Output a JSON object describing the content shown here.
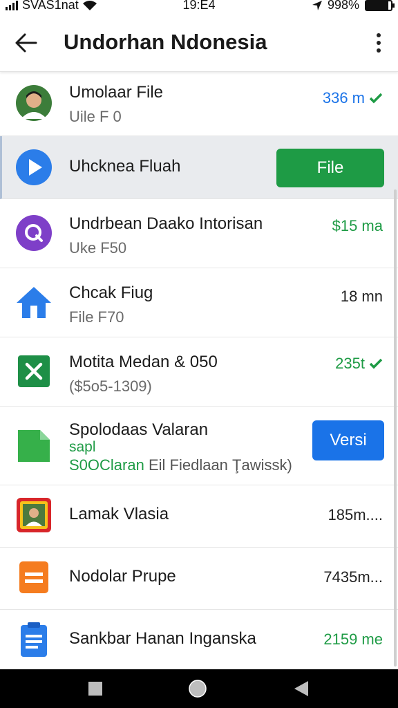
{
  "status_bar": {
    "carrier": "SVAS1nat",
    "time": "19:E4",
    "battery": "998%",
    "battery_level": 0.9
  },
  "app_bar": {
    "title": "Undorhan Ndonesia",
    "back_icon": "arrow-left-icon",
    "menu_icon": "more-vert-icon"
  },
  "rows": [
    {
      "title": "Umolaar File",
      "subtitle": "Uile F 0",
      "meta": "336 m",
      "meta_color": "#1a73e8",
      "check": true,
      "icon": "avatar-photo"
    },
    {
      "title": "Uhcknea Fluah",
      "button": "File",
      "icon": "play-icon",
      "selected": true
    },
    {
      "title": "Undrbean Daako Intorisan",
      "subtitle": "Uke F50",
      "meta": "$15 ma",
      "meta_color": "#1e9b45",
      "icon": "search-q-icon"
    },
    {
      "title": "Chcak Fiug",
      "subtitle": "File F70",
      "meta": "18 mn",
      "meta_color": "#222",
      "icon": "home-icon"
    },
    {
      "title": "Motita Medan & 050",
      "subtitle": "($5o5-1309)",
      "meta": "235t",
      "meta_color": "#1e9b45",
      "check": true,
      "icon": "spreadsheet-icon"
    },
    {
      "title": "Spolodaas Valaran",
      "subtitle": "sapl",
      "detail_green": "S0OClaran",
      "detail_gray": " Eil Fiedlaan Ţawissk)",
      "button": "Versi",
      "icon": "document-green-icon"
    },
    {
      "title": "Lamak Vlasia",
      "meta": "185m....",
      "meta_color": "#222",
      "icon": "framed-photo-icon"
    },
    {
      "title": "Nodolar Prupe",
      "meta": "7435m...",
      "meta_color": "#222",
      "icon": "slides-icon"
    },
    {
      "title": "Sankbar Hanan Inganska",
      "meta": "2159 me",
      "meta_color": "#1e9b45",
      "icon": "docs-icon"
    }
  ],
  "nav_bar": {
    "recent_icon": "square-icon",
    "home_icon": "circle-icon",
    "back_icon": "triangle-back-icon"
  }
}
